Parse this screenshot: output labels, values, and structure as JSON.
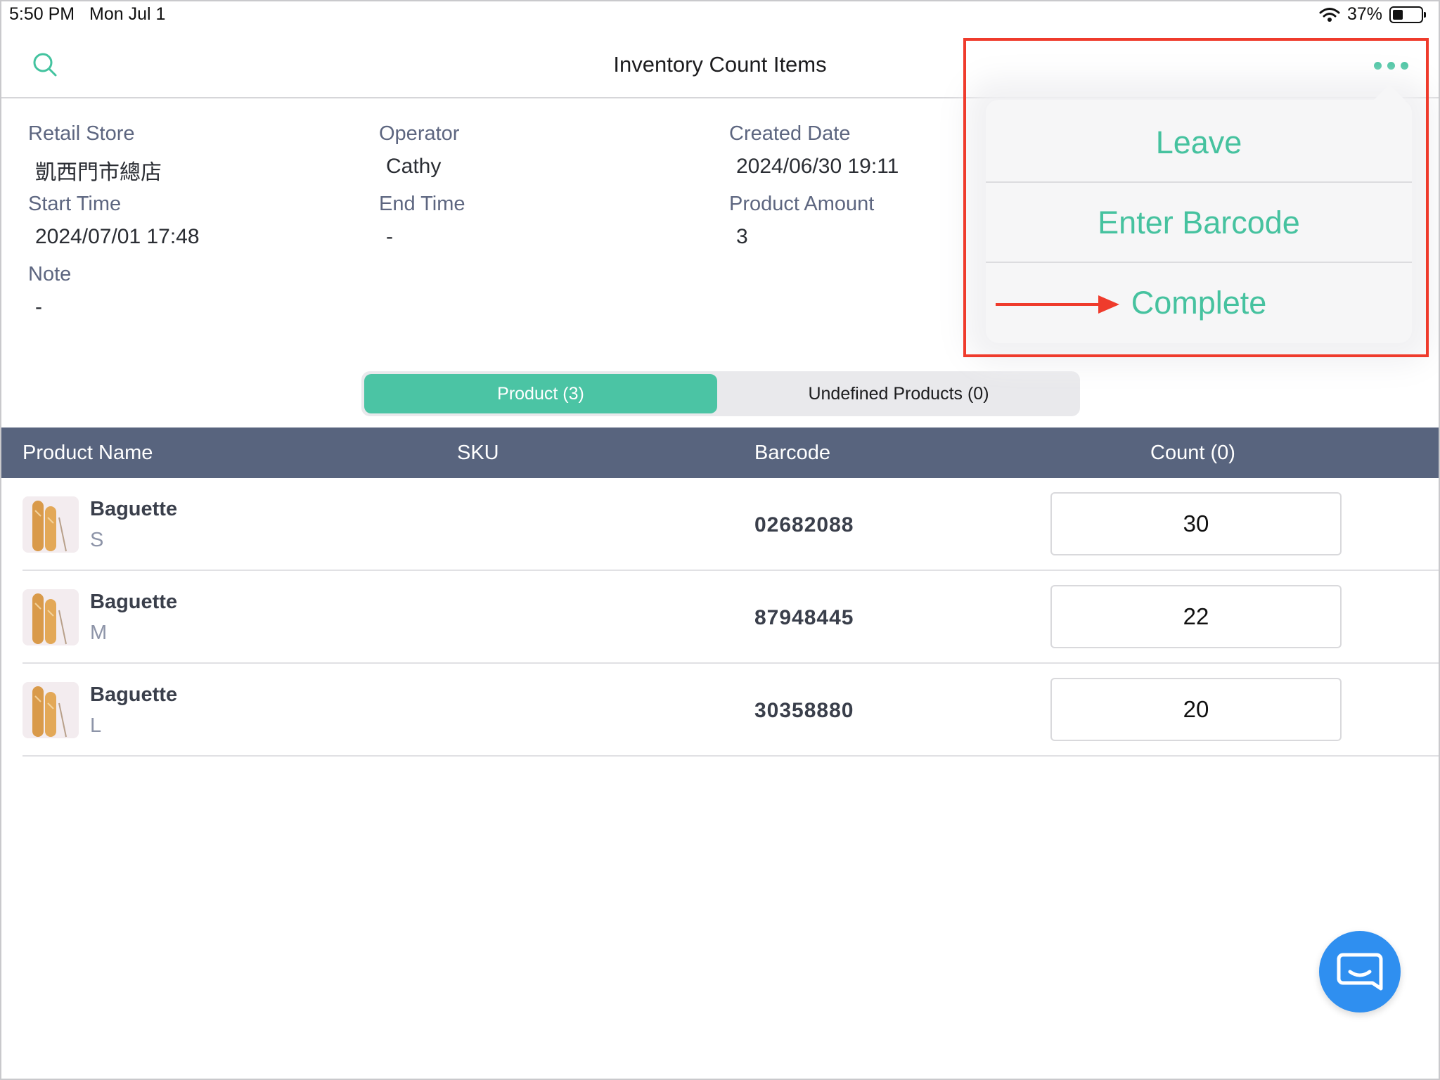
{
  "status_bar": {
    "time": "5:50 PM",
    "date": "Mon Jul 1",
    "battery": "37%"
  },
  "nav": {
    "title": "Inventory Count Items"
  },
  "info": {
    "retail_store_label": "Retail Store",
    "retail_store_value": "凱西門市總店",
    "operator_label": "Operator",
    "operator_value": "Cathy",
    "created_date_label": "Created Date",
    "created_date_value": "2024/06/30 19:11",
    "start_time_label": "Start Time",
    "start_time_value": "2024/07/01 17:48",
    "end_time_label": "End Time",
    "end_time_value": "-",
    "product_amount_label": "Product Amount",
    "product_amount_value": "3",
    "note_label": "Note",
    "note_value": "-"
  },
  "tabs": {
    "product": "Product (3)",
    "undefined": "Undefined Products (0)"
  },
  "table": {
    "headers": {
      "name": "Product Name",
      "sku": "SKU",
      "barcode": "Barcode",
      "count": "Count (0)"
    },
    "rows": [
      {
        "name": "Baguette",
        "variant": "S",
        "barcode": "02682088",
        "count": "30"
      },
      {
        "name": "Baguette",
        "variant": "M",
        "barcode": "87948445",
        "count": "22"
      },
      {
        "name": "Baguette",
        "variant": "L",
        "barcode": "30358880",
        "count": "20"
      }
    ]
  },
  "menu": {
    "leave": "Leave",
    "enter_barcode": "Enter Barcode",
    "complete": "Complete"
  },
  "colors": {
    "accent": "#4bc4a4",
    "header_bg": "#58647e",
    "annotation": "#ef3b2c",
    "fab": "#2f8ff0"
  }
}
